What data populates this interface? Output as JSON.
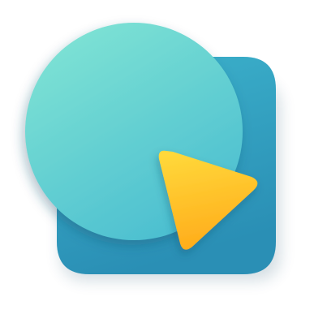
{
  "logo": {
    "name": "app-logo",
    "shapes": [
      "rounded-square",
      "circle",
      "triangle"
    ],
    "colors": {
      "square_top": "#3db3cc",
      "square_bottom": "#2a8fb5",
      "circle_top": "#7fe3d4",
      "circle_bottom": "#48bcd0",
      "triangle_top": "#ffd83a",
      "triangle_bottom": "#ffab1a",
      "shadow": "#1b4f6a"
    }
  }
}
